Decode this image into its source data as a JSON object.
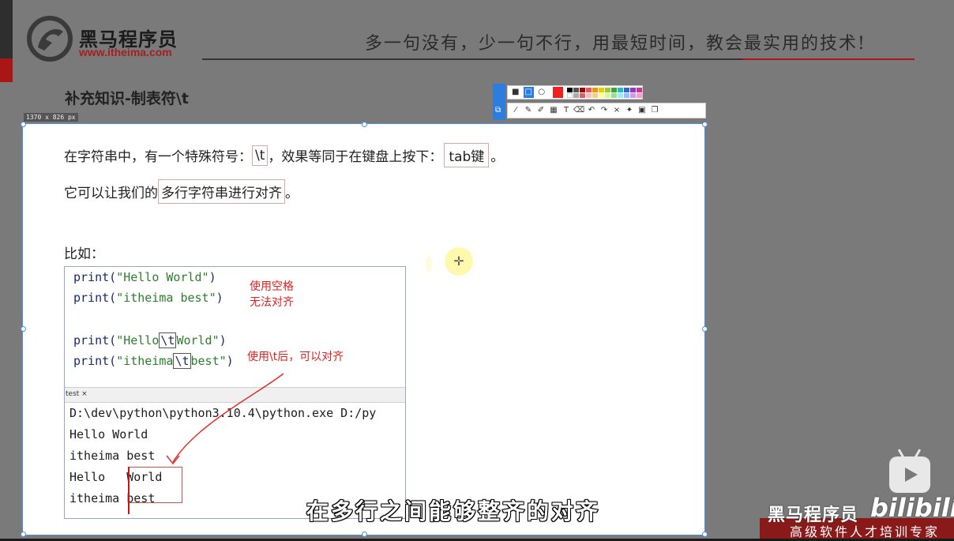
{
  "header": {
    "brand_cn": "黑马程序员",
    "brand_url": "www.itheima.com",
    "slogan": "多一句没有，少一句不行，用最短时间，教会最实用的技术!"
  },
  "slide": {
    "title": "补充知识-制表符\\t"
  },
  "capture": {
    "size_label": "1370 x 826  px",
    "toolbar_icons": [
      "rectangle-icon",
      "rect-outline-icon",
      "ellipse-icon",
      "line-icon",
      "pencil-icon",
      "marker-icon",
      "mosaic-icon",
      "text-icon",
      "eraser-icon",
      "undo-icon",
      "redo-icon",
      "close-icon",
      "pin-icon",
      "save-icon",
      "copy-icon"
    ],
    "accent_color": "#2d7ce0",
    "selected_color": "#ee2020"
  },
  "content": {
    "line1_a": "在字符串中，有一个特殊符号：",
    "line1_box1": "\\t",
    "line1_b": "，效果等同于在键盘上按下：",
    "line1_box2": "tab键",
    "line1_c": "。",
    "line2_a": "它可以让我们的",
    "line2_box": "多行字符串进行对齐",
    "line2_c": "。",
    "example_label": "比如："
  },
  "code": {
    "lines": [
      {
        "pre": "print(",
        "str": "\"Hello World\"",
        "post": ")"
      },
      {
        "pre": "print(",
        "str": "\"itheima best\"",
        "post": ")"
      },
      {
        "pre": "print(",
        "str_a": "\"Hello",
        "tab": "\\t",
        "str_b": "World\"",
        "post": ")"
      },
      {
        "pre": "print(",
        "str_a": "\"itheima",
        "tab": "\\t",
        "str_b": "best\"",
        "post": ")"
      }
    ],
    "note1_line1": "使用空格",
    "note1_line2": "无法对齐",
    "note2": "使用\\t后，可以对齐",
    "tab_label": "test ×",
    "output": [
      "D:\\dev\\python\\python3.10.4\\python.exe D:/py",
      "Hello World",
      "itheima best",
      "Hello   World",
      "itheima best"
    ]
  },
  "subtitle": "在多行之间能够整齐的对齐",
  "watermark": {
    "brand": "黑马程序员",
    "bili": "bilibili",
    "sub": "高级软件人才培训专家"
  }
}
